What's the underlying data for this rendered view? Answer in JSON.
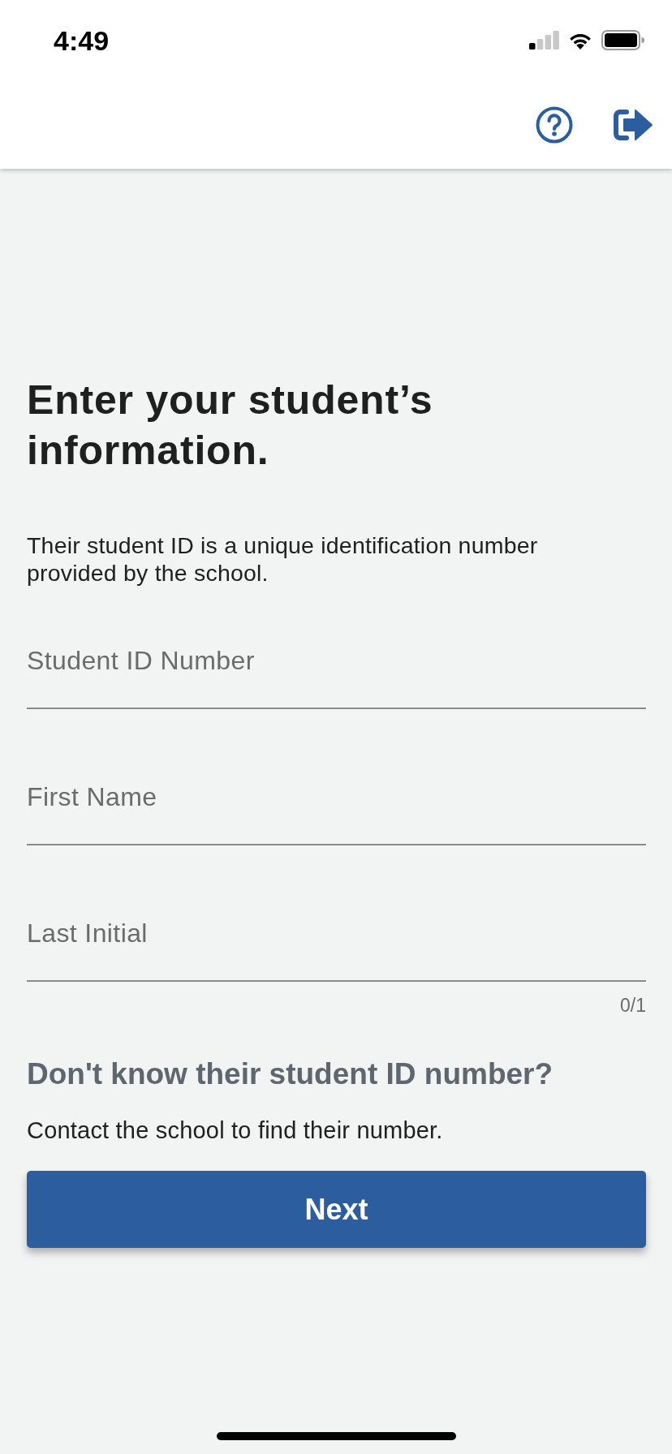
{
  "status_bar": {
    "time": "4:49"
  },
  "title": "Enter your student’s information.",
  "description": "Their student ID is a unique identification number provided by the school.",
  "fields": [
    {
      "placeholder": "Student ID Number"
    },
    {
      "placeholder": "First Name"
    },
    {
      "placeholder": "Last Initial",
      "counter": "0/1"
    }
  ],
  "help": {
    "heading": "Don't know their student ID number?",
    "text": "Contact the school to find their number."
  },
  "next_button": {
    "label": "Next"
  }
}
